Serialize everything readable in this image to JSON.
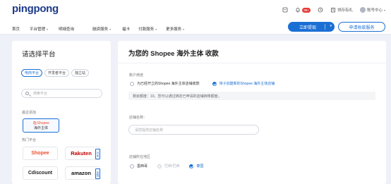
{
  "header": {
    "logo": "pingpong",
    "icons": [
      {
        "name": "clipboard-icon"
      },
      {
        "name": "bell-icon",
        "badge": "99+"
      },
      {
        "name": "clock-icon"
      },
      {
        "name": "building-icon",
        "label": "领存有礼"
      },
      {
        "name": "user-icon",
        "label": "账号中心"
      }
    ],
    "nav": [
      {
        "label": "首页",
        "dropdown": false
      },
      {
        "label": "平台管理",
        "dropdown": true
      },
      {
        "label": "明细查询",
        "dropdown": false
      },
      {
        "label": "融资服务",
        "dropdown": true
      },
      {
        "label": "福卡",
        "dropdown": false
      },
      {
        "label": "付款服务",
        "dropdown": true
      },
      {
        "label": "更多服务",
        "dropdown": true
      }
    ],
    "login_button": "立即提现",
    "apply_button": "申请收款服务"
  },
  "left": {
    "title": "请选择平台",
    "chips": [
      "电商平台",
      "开发者平台",
      "独立站"
    ],
    "search_placeholder": "搜索平台",
    "recent_label": "最近添加",
    "recent_card": {
      "brand": "Shopee",
      "sub": "海外主体"
    },
    "hot_label": "热门平台",
    "platforms": [
      {
        "name": "Shopee",
        "color": "#ee4d2d",
        "tag": ""
      },
      {
        "name": "Rakuten",
        "color": "#bf0000",
        "tag": "日本"
      },
      {
        "name": "Cdiscount",
        "color": "#222222",
        "tag": ""
      },
      {
        "name": "amazon",
        "color": "#111111",
        "tag": "多国"
      }
    ]
  },
  "right": {
    "title": "为您的 Shopee 海外主体 收款",
    "purpose_label": "账户用途",
    "purpose_options": [
      {
        "label": "为已经开立的Shopee 海外主体店铺收款",
        "selected": false
      },
      {
        "label": "将子创建新的Shopee 海外主体店铺",
        "selected": true
      }
    ],
    "notice": "剩余额度：10，您可以通过绑定已申请的店铺转移额度。",
    "store_label": "店铺名称：",
    "store_placeholder": "请您提供店铺名称",
    "region_label": "店铺所在地区",
    "regions": [
      {
        "label": "墨西哥",
        "state": "off"
      },
      {
        "label": "巴西/巴西",
        "state": "disabled"
      },
      {
        "label": "泰国",
        "state": "on"
      }
    ]
  }
}
